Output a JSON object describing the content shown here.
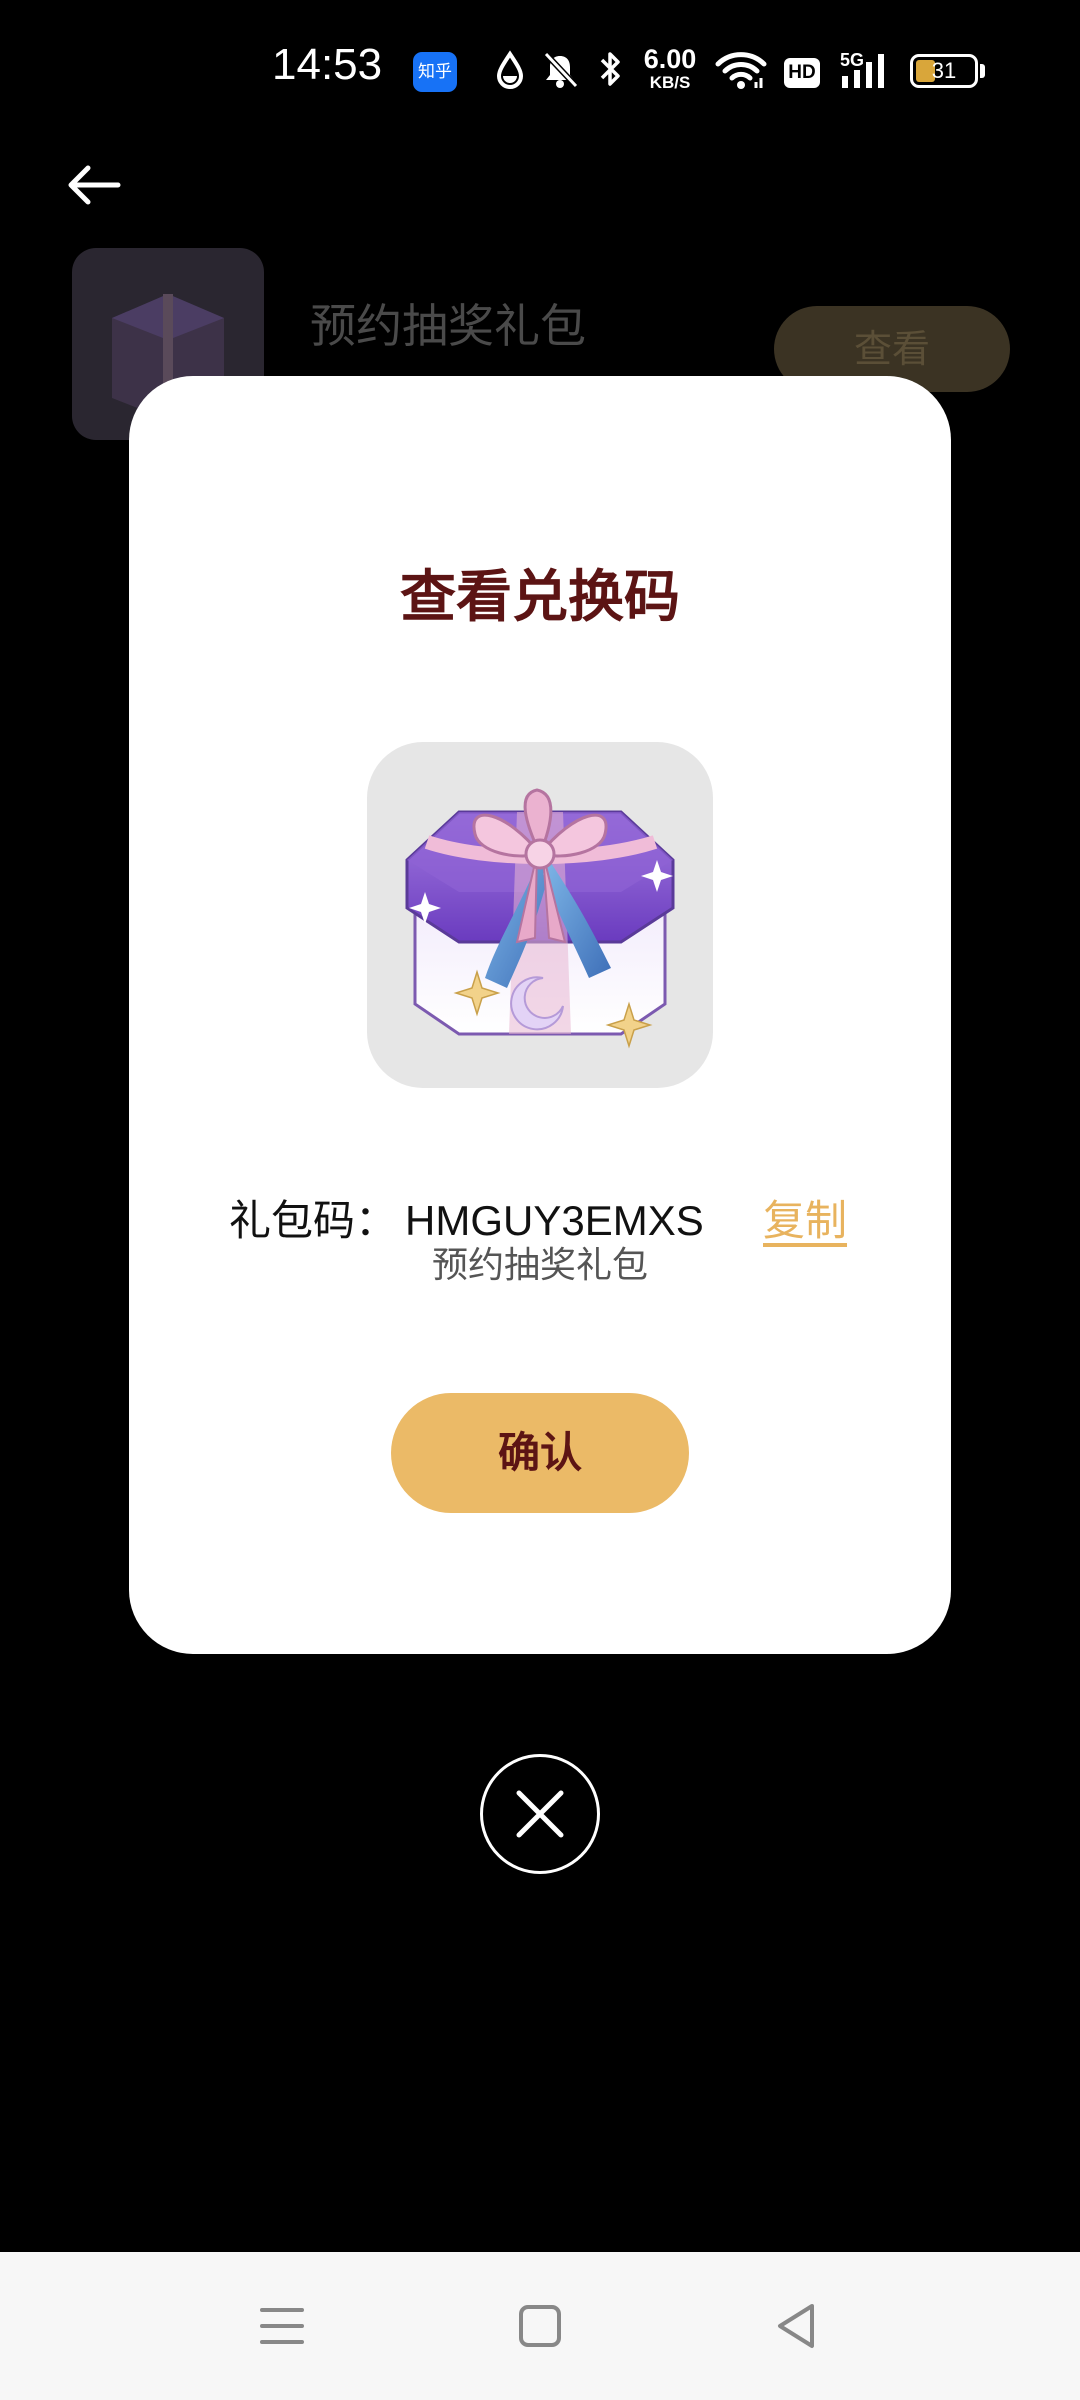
{
  "status_bar": {
    "time": "14:53",
    "zhihu_badge": "知乎",
    "network_speed_value": "6.00",
    "network_speed_unit": "KB/S",
    "hd_label": "HD",
    "signal_label": "5G",
    "battery_level": "31",
    "icons": [
      "zhihu-app-icon",
      "water-drop-icon",
      "bell-off-icon",
      "bluetooth-icon",
      "wifi-icon",
      "hd-icon",
      "signal-5g-icon",
      "battery-icon"
    ]
  },
  "background_page": {
    "back_icon": "arrow-left-icon",
    "card": {
      "title": "预约抽奖礼包",
      "subtitle": "",
      "action_label": "查看"
    }
  },
  "dialog": {
    "title": "查看兑换码",
    "gift_icon": "gift-box-icon",
    "code_label": "礼包码：",
    "code_value": "HMGUY3EMXS",
    "copy_label": "复制",
    "gift_name": "预约抽奖礼包",
    "confirm_label": "确认",
    "close_icon": "close-icon"
  },
  "nav_bar": {
    "icons": [
      "menu-icon",
      "home-square-icon",
      "back-triangle-icon"
    ]
  },
  "colors": {
    "title_text": "#5c1414",
    "confirm_button": "#ebba67",
    "copy_link": "#e8b35e",
    "background": "#000000",
    "modal": "#ffffff"
  }
}
